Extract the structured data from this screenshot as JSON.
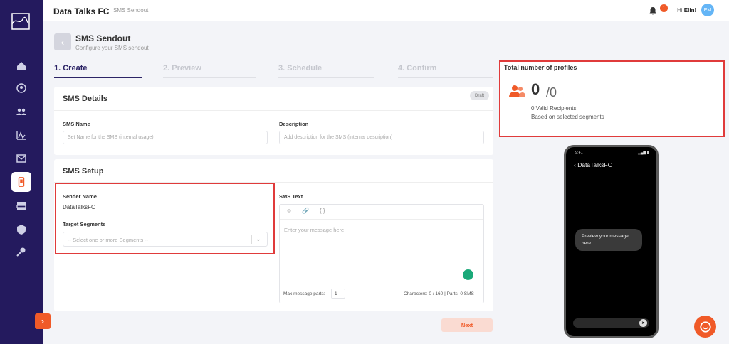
{
  "app": {
    "brand": "Data Talks FC",
    "breadcrumb": "SMS Sendout"
  },
  "header": {
    "notifications": "1",
    "greeting_prefix": "Hi ",
    "user_name": "Elin!",
    "avatar_initials": "EM"
  },
  "page": {
    "title": "SMS Sendout",
    "subtitle": "Configure your SMS sendout"
  },
  "steps": [
    {
      "label": "1. Create",
      "active": true
    },
    {
      "label": "2. Preview",
      "active": false
    },
    {
      "label": "3. Schedule",
      "active": false
    },
    {
      "label": "4. Confirm",
      "active": false
    }
  ],
  "details": {
    "title": "SMS Details",
    "status": "Draft",
    "name_label": "SMS Name",
    "name_placeholder": "Set Name for the SMS (internal usage)",
    "desc_label": "Description",
    "desc_placeholder": "Add description for the SMS (internal description)"
  },
  "setup": {
    "title": "SMS Setup",
    "sender_label": "Sender Name",
    "sender_value": "DataTalksFC",
    "segments_label": "Target Segments",
    "segments_placeholder": "-- Select one or more Segments --",
    "text_label": "SMS Text",
    "text_placeholder": "Enter your message here",
    "tools": [
      "☺",
      "🔗",
      "{ }"
    ],
    "parts_label": "Max message parts:",
    "parts_value": "1",
    "counter": "Characters: 0 / 160 | Parts: 0 SMS"
  },
  "next_label": "Next",
  "profiles": {
    "title": "Total number of profiles",
    "count": "0",
    "total": "/0",
    "valid": "0 Valid Recipients",
    "based": "Based on selected segments"
  },
  "phone": {
    "time": "9:41",
    "sender": "DataTalksFC",
    "bubble": "Preview your message here"
  },
  "colors": {
    "accent": "#f05a28",
    "sidebar": "#241a5e",
    "highlight": "#e03b3b"
  }
}
